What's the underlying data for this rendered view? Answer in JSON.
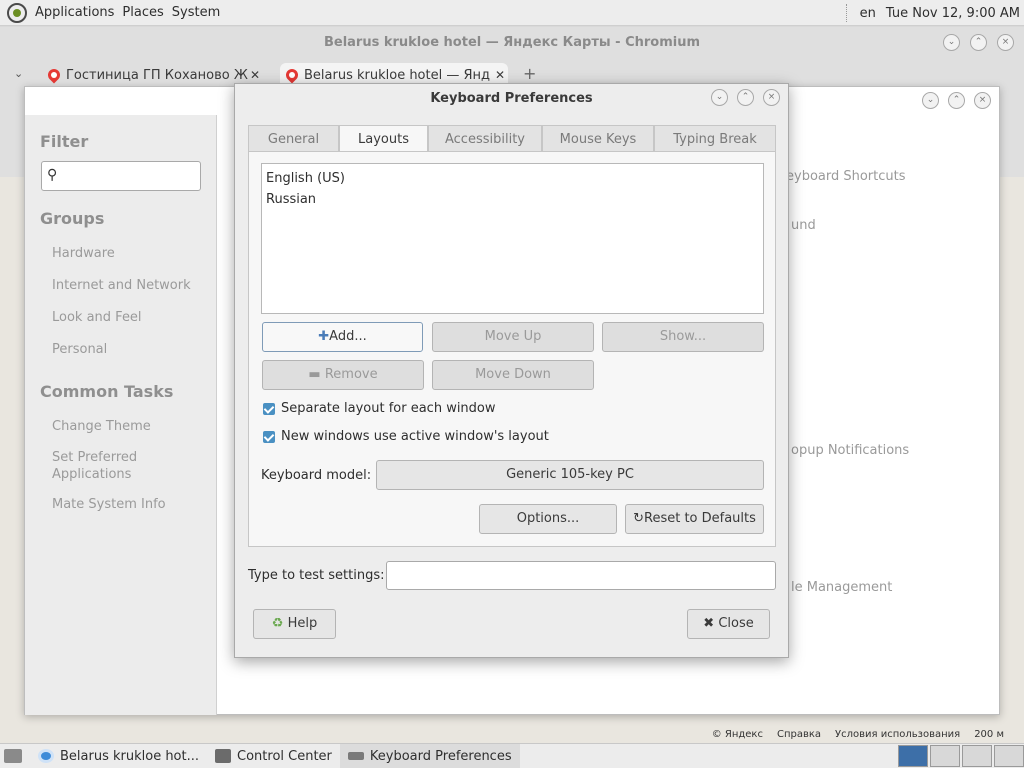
{
  "top_panel": {
    "menus": [
      "Applications",
      "Places",
      "System"
    ],
    "keyboard_indicator": "en",
    "clock": "Tue Nov 12,  9:00 AM"
  },
  "chromium": {
    "title": "Belarus krukloe hotel — Яндекс Карты - Chromium",
    "tabs": [
      {
        "label": "Гостиница ГП Коханово Ж"
      },
      {
        "label": "Belarus krukloe hotel — Янд"
      }
    ],
    "map_footer": [
      "© Яндекс",
      "Справка",
      "Условия использования",
      "200 м"
    ]
  },
  "control_center": {
    "filter_heading": "Filter",
    "groups_heading": "Groups",
    "groups": [
      "Hardware",
      "Internet and Network",
      "Look and Feel",
      "Personal"
    ],
    "tasks_heading": "Common Tasks",
    "tasks": [
      "Change Theme",
      "Set Preferred Applications",
      "Mate System Info"
    ],
    "partial_items": [
      "eyboard Shortcuts",
      "und",
      "opup Notifications",
      "le Management"
    ]
  },
  "dialog": {
    "title": "Keyboard Preferences",
    "tabs": [
      "General",
      "Layouts",
      "Accessibility",
      "Mouse Keys",
      "Typing Break"
    ],
    "selected_tab": "Layouts",
    "layouts": [
      "English (US)",
      "Russian"
    ],
    "buttons": {
      "add": "Add...",
      "move_up": "Move Up",
      "show": "Show...",
      "remove": "Remove",
      "move_down": "Move Down",
      "options": "Options...",
      "reset": "Reset to Defaults",
      "help": "Help",
      "close": "Close"
    },
    "checkboxes": {
      "separate_layout": "Separate layout for each window",
      "new_windows": "New windows use active window's layout"
    },
    "keyboard_model_label": "Keyboard model:",
    "keyboard_model_value": "Generic 105-key PC",
    "test_label": "Type to test settings:",
    "test_value": ""
  },
  "taskbar": {
    "items": [
      "Belarus krukloe hot...",
      "Control Center",
      "Keyboard Preferences"
    ]
  }
}
